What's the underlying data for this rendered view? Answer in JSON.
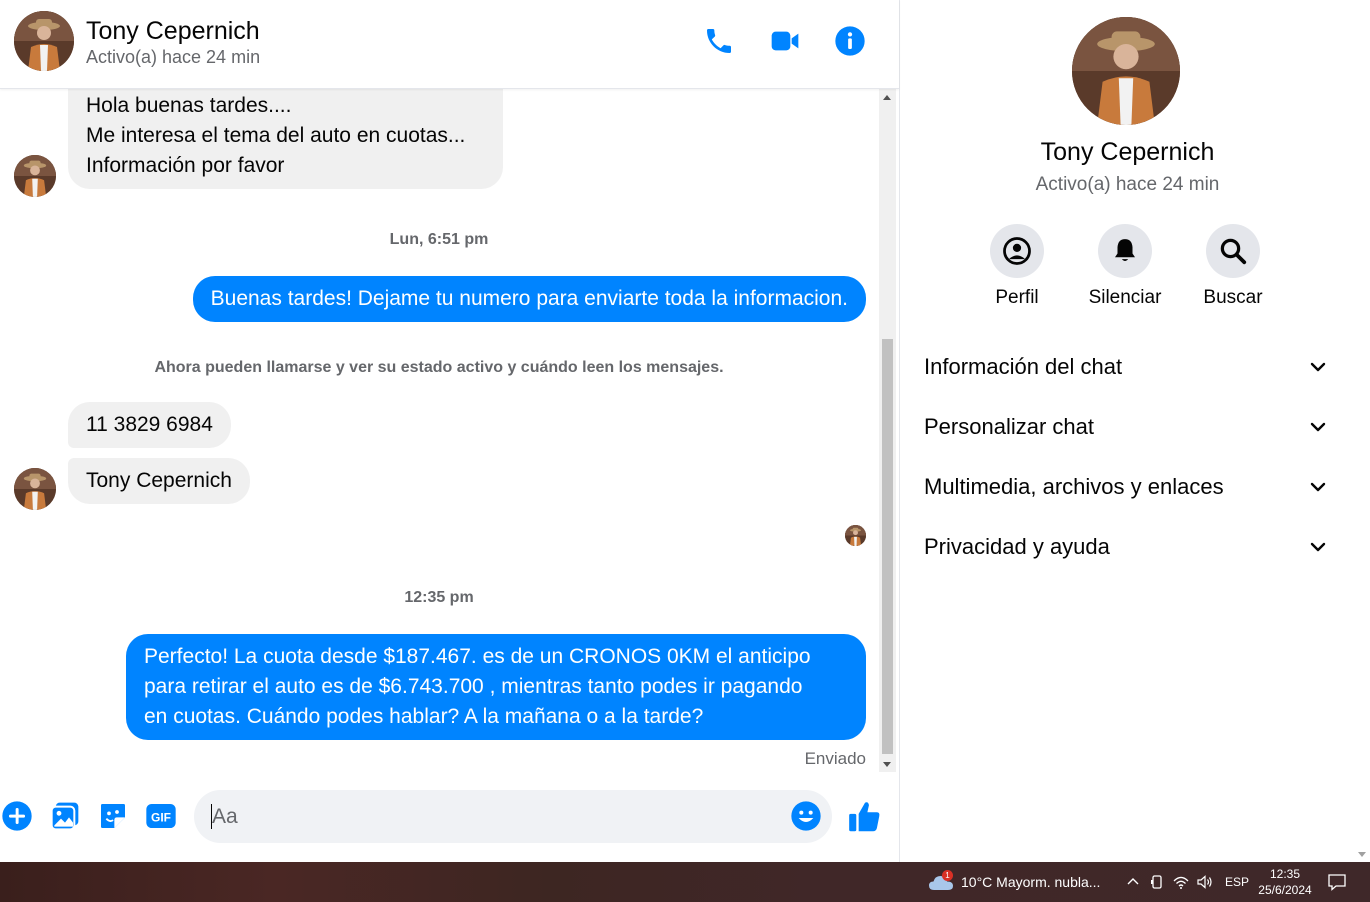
{
  "contact": {
    "name": "Tony Cepernich",
    "status": "Activo(a) hace 24 min"
  },
  "header_actions": {
    "call": "phone-icon",
    "video": "video-icon",
    "info": "info-icon"
  },
  "messages": {
    "m1": {
      "lines": [
        "Hola buenas tardes....",
        "Me interesa el tema del auto en cuotas...",
        "Información por favor"
      ]
    },
    "ts1": "Lun, 6:51 pm",
    "m2": "Buenas tardes! Dejame tu numero para enviarte toda la informacion.",
    "system_note": "Ahora pueden llamarse y ver su estado activo y cuándo leen los mensajes.",
    "m3": "11 3829 6984",
    "m4": "Tony Cepernich",
    "ts2": "12:35 pm",
    "m5": {
      "lines": [
        "Perfecto! La cuota desde $187.467. es de un CRONOS 0KM el anticipo",
        "para retirar el auto es de $6.743.700 , mientras tanto podes ir pagando",
        "en cuotas. Cuándo podes hablar? A la mañana o a la tarde?"
      ]
    },
    "sent_status": "Enviado"
  },
  "composer": {
    "placeholder": "Aa",
    "gif_label": "GIF"
  },
  "info_panel": {
    "actions": [
      {
        "label": "Perfil",
        "icon": "profile-icon"
      },
      {
        "label": "Silenciar",
        "icon": "bell-icon"
      },
      {
        "label": "Buscar",
        "icon": "search-icon"
      }
    ],
    "sections": [
      "Información del chat",
      "Personalizar chat",
      "Multimedia, archivos y enlaces",
      "Privacidad y ayuda"
    ]
  },
  "taskbar": {
    "weather": "10°C  Mayorm. nubla...",
    "weather_badge": "1",
    "language": "ESP",
    "time": "12:35",
    "date": "25/6/2024"
  },
  "colors": {
    "accent": "#0084ff",
    "incoming_bubble": "#f0f0f0",
    "muted_text": "#65676b"
  }
}
